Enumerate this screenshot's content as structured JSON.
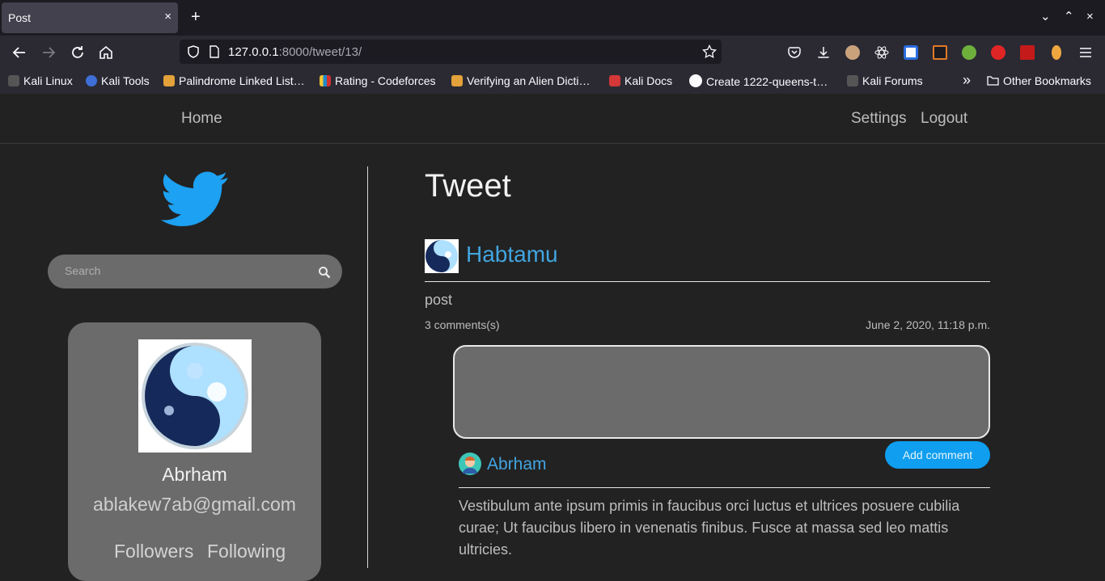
{
  "browser": {
    "tab_title": "Post",
    "close_symbol": "×",
    "new_tab_symbol": "+",
    "window_controls": [
      "⌄",
      "⌃",
      "×"
    ],
    "url_host": "127.0.0.1",
    "url_path": ":8000/tweet/13/",
    "bookmarks": [
      {
        "label": "Kali Linux",
        "icon": "kali-dragon-icon",
        "color": "#2b2a33"
      },
      {
        "label": "Kali Tools",
        "icon": "kali-tools-icon",
        "color": "#3d6fd6"
      },
      {
        "label": "Palindrome Linked List…",
        "icon": "leetcode-icon",
        "color": "#e3a23a"
      },
      {
        "label": "Rating - Codeforces",
        "icon": "codeforces-icon",
        "color": "#1f8acb"
      },
      {
        "label": "Verifying an Alien Dicti…",
        "icon": "leetcode-icon",
        "color": "#e3a23a"
      },
      {
        "label": "Kali Docs",
        "icon": "kali-docs-icon",
        "color": "#d43838"
      },
      {
        "label": "Create 1222-queens-t…",
        "icon": "github-icon",
        "color": "#fbfbfe"
      },
      {
        "label": "Kali Forums",
        "icon": "kali-forums-icon",
        "color": "#2b2a33"
      }
    ],
    "overflow_symbol": "»",
    "other_bookmarks": "Other Bookmarks"
  },
  "site_nav": {
    "home": "Home",
    "settings": "Settings",
    "logout": "Logout"
  },
  "sidebar": {
    "search_placeholder": "Search",
    "profile": {
      "name": "Abrham",
      "email": "ablakew7ab@gmail.com",
      "followers": "Followers",
      "following": "Following"
    }
  },
  "tweet": {
    "heading": "Tweet",
    "author": "Habtamu",
    "text": "post",
    "comments_count": "3 comments(s)",
    "date": "June 2, 2020, 11:18 p.m.",
    "add_comment_label": "Add comment",
    "comment": {
      "author": "Abrham",
      "text": "Vestibulum ante ipsum primis in faucibus orci luctus et ultrices posuere cubilia curae; Ut faucibus libero in venenatis finibus. Fusce at massa sed leo mattis ultricies."
    }
  },
  "colors": {
    "accent_blue": "#42a5e0",
    "button_blue": "#0f9ef0",
    "twitter_blue": "#1da1f2",
    "panel_grey": "#6b6b6b",
    "page_bg": "#222222"
  }
}
